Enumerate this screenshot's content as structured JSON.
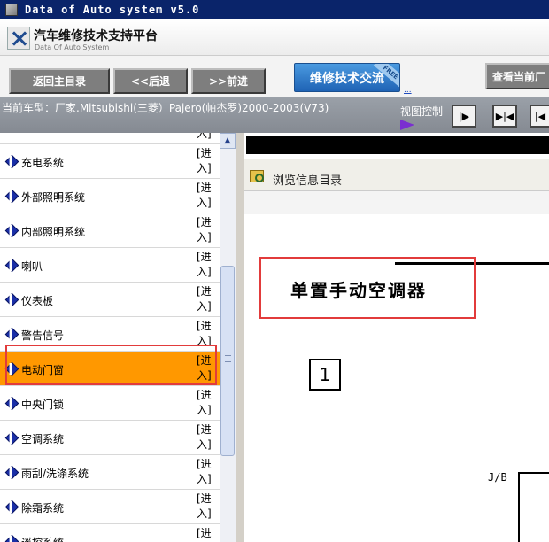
{
  "window": {
    "title": "Data of Auto system v5.0"
  },
  "header": {
    "title": "汽车维修技术支持平台",
    "subtitle": "Data Of Auto System"
  },
  "nav": {
    "back_main": "返回主目录",
    "back": "<<后退",
    "forward": ">>前进",
    "exchange": "维修技术交流",
    "exchange_badge": "FREE",
    "ellipsis_link": "...",
    "view_current": "查看当前厂"
  },
  "model_bar": {
    "text": "当前车型：厂家.Mitsubishi(三菱）Pajero(帕杰罗)2000-2003(V73)",
    "view_control_label": "视图控制"
  },
  "list": {
    "enter_label": "[进入]",
    "items": [
      {
        "label": "",
        "selected": false
      },
      {
        "label": "充电系统",
        "selected": false
      },
      {
        "label": "外部照明系统",
        "selected": false
      },
      {
        "label": "内部照明系统",
        "selected": false
      },
      {
        "label": "喇叭",
        "selected": false
      },
      {
        "label": "仪表板",
        "selected": false
      },
      {
        "label": "警告信号",
        "selected": false
      },
      {
        "label": "电动门窗",
        "selected": true
      },
      {
        "label": "中央门锁",
        "selected": false
      },
      {
        "label": "空调系统",
        "selected": false
      },
      {
        "label": "雨刮/洗涤系统",
        "selected": false
      },
      {
        "label": "除霜系统",
        "selected": false
      },
      {
        "label": "遥控系统",
        "selected": false
      }
    ]
  },
  "browse": {
    "title": "浏览信息目录"
  },
  "document": {
    "heading": "单置手动空调器",
    "figure_number": "1",
    "jb_label": "J/B"
  },
  "colors": {
    "selected_row": "#ff9800",
    "highlight_outline": "#e23b3b",
    "title_bar": "#0a246a"
  }
}
